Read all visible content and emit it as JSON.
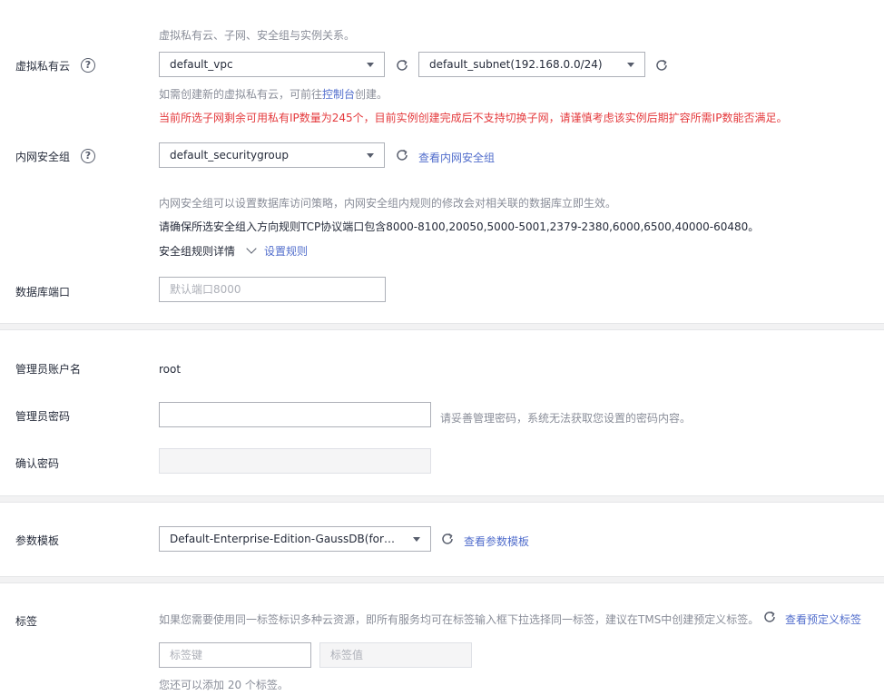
{
  "vpc": {
    "top_hint": "虚拟私有云、子网、安全组与实例关系。",
    "label": "虚拟私有云",
    "vpc_value": "default_vpc",
    "subnet_value": "default_subnet(192.168.0.0/24)",
    "create_hint_prefix": "如需创建新的虚拟私有云，可前往",
    "create_hint_link": "控制台",
    "create_hint_suffix": "创建。",
    "warning": "当前所选子网剩余可用私有IP数量为245个，目前实例创建完成后不支持切换子网，请谨慎考虑该实例后期扩容所需IP数能否满足。"
  },
  "security": {
    "label": "内网安全组",
    "value": "default_securitygroup",
    "view_link": "查看内网安全组",
    "hint": "内网安全组可以设置数据库访问策略，内网安全组内规则的修改会对相关联的数据库立即生效。",
    "port_notice": "请确保所选安全组入方向规则TCP协议端口包含8000-8100,20050,5000-5001,2379-2380,6000,6500,40000-60480。",
    "rules_detail": "安全组规则详情",
    "set_rules": "设置规则"
  },
  "db_port": {
    "label": "数据库端口",
    "placeholder": "默认端口8000"
  },
  "admin": {
    "account_label": "管理员账户名",
    "account_value": "root",
    "password_label": "管理员密码",
    "password_hint": "请妥善管理密码，系统无法获取您设置的密码内容。",
    "confirm_label": "确认密码"
  },
  "params": {
    "label": "参数模板",
    "value": "Default-Enterprise-Edition-GaussDB(for openGauss)",
    "view_link": "查看参数模板"
  },
  "tags": {
    "label": "标签",
    "hint": "如果您需要使用同一标签标识多种云资源，即所有服务均可在标签输入框下拉选择同一标签，建议在TMS中创建预定义标签。",
    "view_link": "查看预定义标签",
    "key_placeholder": "标签键",
    "value_placeholder": "标签值",
    "remaining": "您还可以添加 20 个标签。"
  },
  "colors": {
    "link": "#526ecc",
    "warning": "#e4393c",
    "hint": "#8a8e99"
  }
}
